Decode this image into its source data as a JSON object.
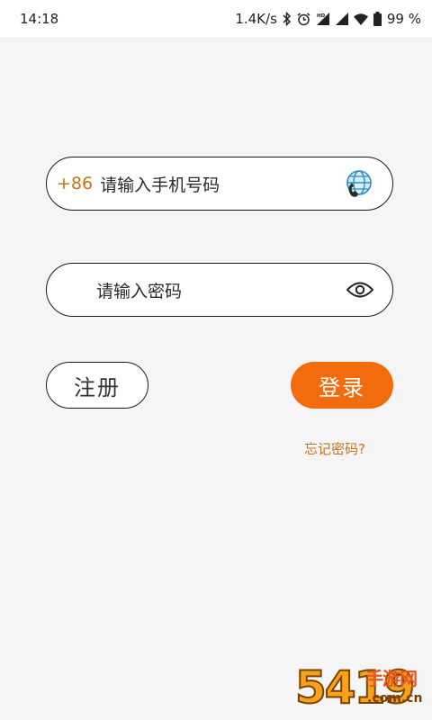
{
  "status_bar": {
    "time": "14:18",
    "network_speed": "1.4K/s",
    "battery_percent": "99 %",
    "icons": [
      "bluetooth-icon",
      "alarm-icon",
      "hd-signal-icon",
      "signal-icon",
      "wifi-icon",
      "battery-icon"
    ]
  },
  "login_form": {
    "country_code": "+86",
    "phone_placeholder": "请输入手机号码",
    "phone_icon": "globe-phone-icon",
    "password_placeholder": "请输入密码",
    "password_icon": "eye-icon",
    "register_label": "注册",
    "login_label": "登录",
    "forgot_password": "忘记密码?"
  },
  "colors": {
    "accent": "#f26c0d",
    "link": "#c4731a",
    "background": "#f5f5f5"
  },
  "watermark": {
    "number": "5419",
    "title": "手游网",
    "domain": ".com.cn"
  }
}
